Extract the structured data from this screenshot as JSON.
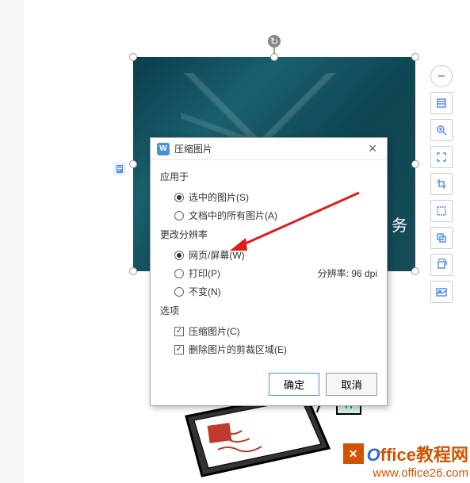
{
  "dialog": {
    "title": "压缩图片",
    "section_apply": "应用于",
    "opt_selected": "选中的图片(S)",
    "opt_all_docs": "文档中的所有图片(A)",
    "section_resolution": "更改分辨率",
    "opt_web": "网页/屏幕(W)",
    "opt_print": "打印(P)",
    "opt_nochange": "不变(N)",
    "dpi_label": "分辨率: 96 dpi",
    "section_options": "选项",
    "chk_compress": "压缩图片(C)",
    "chk_crop": "删除图片的剪裁区域(E)",
    "btn_ok": "确定",
    "btn_cancel": "取消"
  },
  "watermark": {
    "brand_first": "O",
    "brand_rest": "ffice教程网",
    "url": "www.office26.com"
  },
  "image_text": "务"
}
